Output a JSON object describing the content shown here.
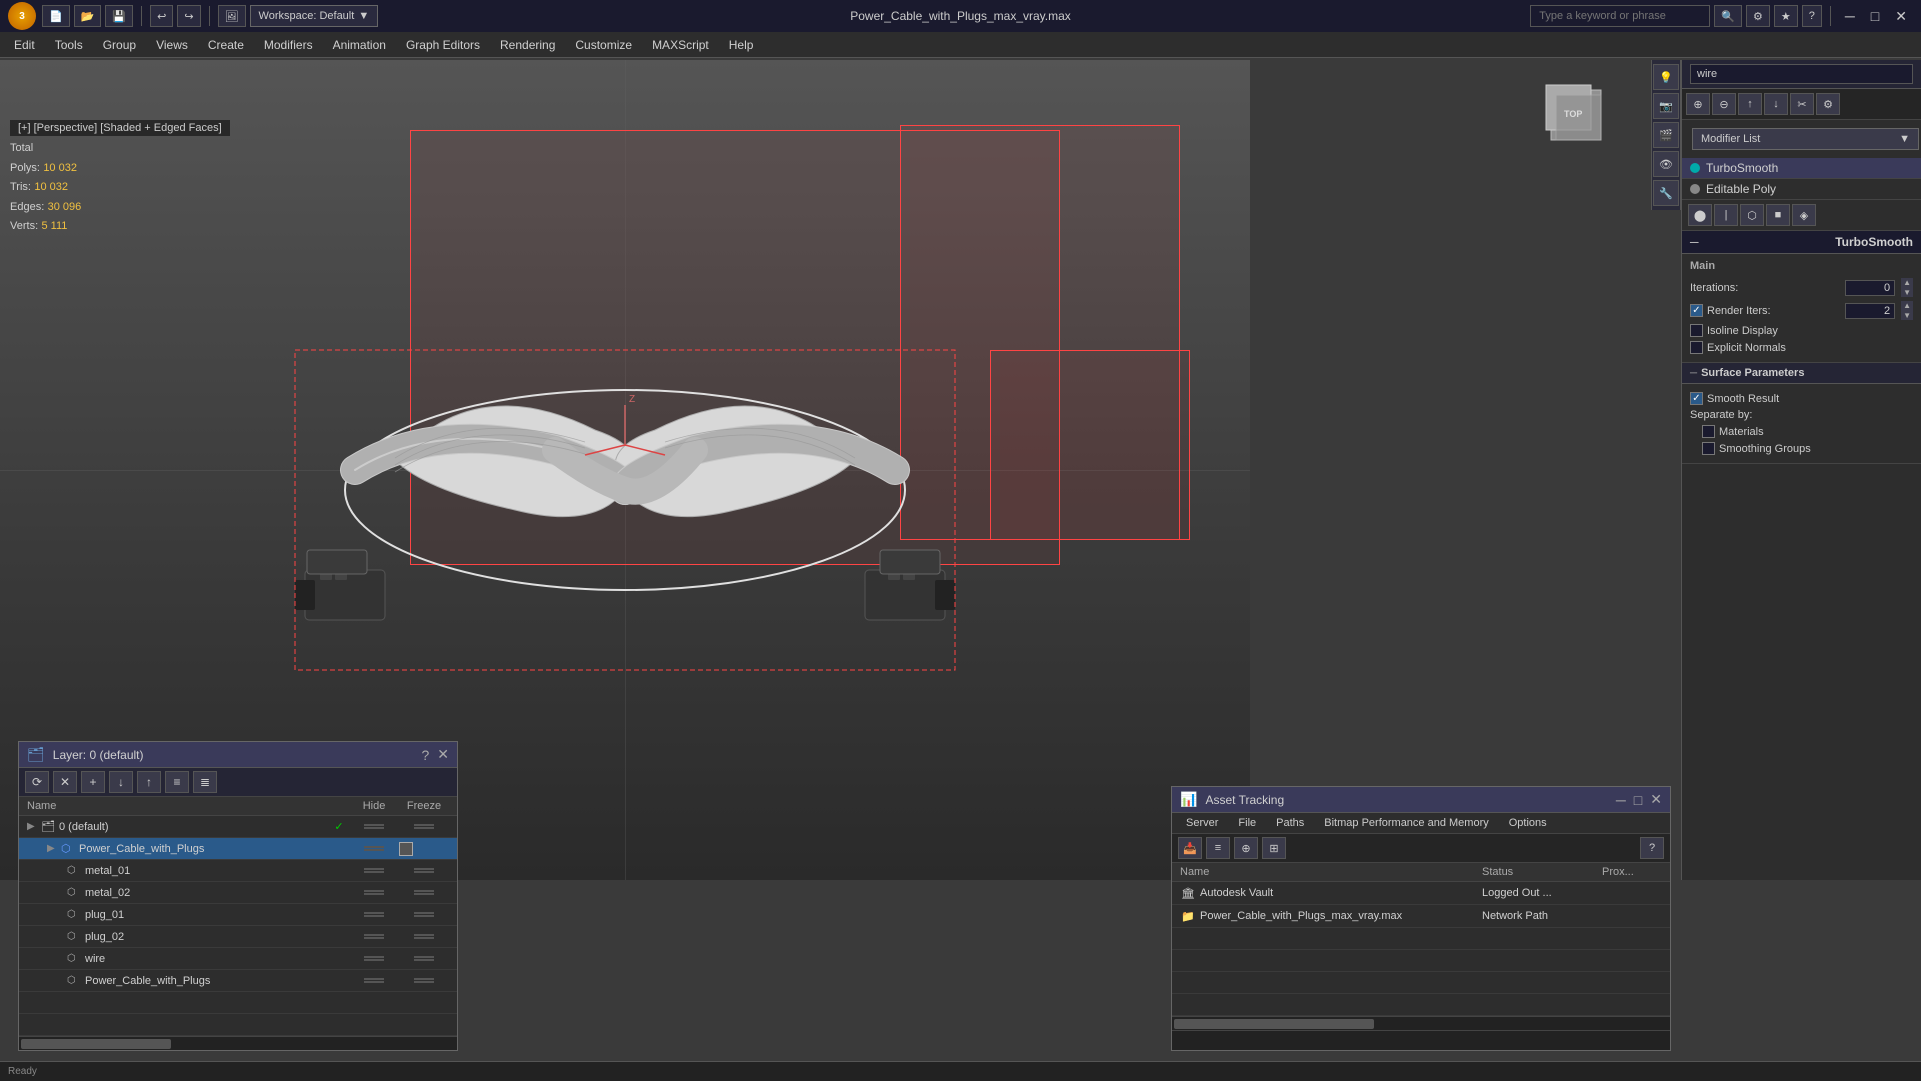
{
  "title_bar": {
    "app_name": "3ds Max",
    "file_title": "Power_Cable_with_Plugs_max_vray.max",
    "workspace_label": "Workspace: Default",
    "search_placeholder": "Type a keyword or phrase",
    "window_controls": [
      "minimize",
      "maximize",
      "close"
    ]
  },
  "menu_bar": {
    "items": [
      "Edit",
      "Tools",
      "Group",
      "Views",
      "Create",
      "Modifiers",
      "Animation",
      "Graph Editors",
      "Rendering",
      "Customize",
      "MAXScript",
      "Help"
    ]
  },
  "viewport": {
    "label": "[+] [Perspective] [Shaded + Edged Faces]",
    "stats": {
      "total_label": "Total",
      "polys_label": "Polys:",
      "polys_value": "10 032",
      "tris_label": "Tris:",
      "tris_value": "10 032",
      "edges_label": "Edges:",
      "edges_value": "30 096",
      "verts_label": "Verts:",
      "verts_value": "5 111"
    }
  },
  "right_panel": {
    "search_value": "wire",
    "modifier_list_label": "Modifier List",
    "modifiers": [
      {
        "name": "TurboSmooth",
        "active": true,
        "dot_color": "teal"
      },
      {
        "name": "Editable Poly",
        "active": false,
        "dot_color": "gray"
      }
    ],
    "turbosmooth": {
      "title": "TurboSmooth",
      "main_label": "Main",
      "iterations_label": "Iterations:",
      "iterations_value": "0",
      "render_iters_label": "Render Iters:",
      "render_iters_value": "2",
      "render_iters_checked": true,
      "isoline_display_label": "Isoline Display",
      "isoline_checked": false,
      "explicit_normals_label": "Explicit Normals",
      "explicit_normals_checked": false,
      "surface_params_title": "Surface Parameters",
      "smooth_result_label": "Smooth Result",
      "smooth_result_checked": true,
      "separate_by_label": "Separate by:",
      "materials_label": "Materials",
      "materials_checked": false,
      "smoothing_groups_label": "Smoothing Groups",
      "smoothing_groups_checked": false
    }
  },
  "layer_panel": {
    "title": "Layer: 0 (default)",
    "help_btn": "?",
    "toolbar_tools": [
      "⟳",
      "✕",
      "+",
      "↓↑",
      "⇅",
      "≡",
      "≣"
    ],
    "columns": {
      "name": "Name",
      "hide": "Hide",
      "freeze": "Freeze"
    },
    "layers": [
      {
        "indent": 0,
        "expand": "▶",
        "icon": "layer",
        "name": "0 (default)",
        "check": "✓",
        "has_box": false
      },
      {
        "indent": 1,
        "expand": "▶",
        "icon": "group",
        "name": "Power_Cable_with_Plugs",
        "check": "",
        "has_box": true,
        "selected": true
      },
      {
        "indent": 2,
        "expand": "",
        "icon": "obj",
        "name": "metal_01",
        "check": "",
        "has_box": false
      },
      {
        "indent": 2,
        "expand": "",
        "icon": "obj",
        "name": "metal_02",
        "check": "",
        "has_box": false
      },
      {
        "indent": 2,
        "expand": "",
        "icon": "obj",
        "name": "plug_01",
        "check": "",
        "has_box": false
      },
      {
        "indent": 2,
        "expand": "",
        "icon": "obj",
        "name": "plug_02",
        "check": "",
        "has_box": false
      },
      {
        "indent": 2,
        "expand": "",
        "icon": "obj",
        "name": "wire",
        "check": "",
        "has_box": false
      },
      {
        "indent": 2,
        "expand": "",
        "icon": "obj",
        "name": "Power_Cable_with_Plugs",
        "check": "",
        "has_box": false
      }
    ]
  },
  "asset_panel": {
    "title": "Asset Tracking",
    "menu_items": [
      "Server",
      "File",
      "Paths",
      "Bitmap Performance and Memory",
      "Options"
    ],
    "columns": {
      "name": "Name",
      "status": "Status",
      "proxy": "Prox..."
    },
    "rows": [
      {
        "icon": "vault",
        "name": "Autodesk Vault",
        "status": "Logged Out ...",
        "proxy": ""
      },
      {
        "icon": "max",
        "name": "Power_Cable_with_Plugs_max_vray.max",
        "status": "Network Path",
        "proxy": ""
      }
    ]
  },
  "icons": {
    "search": "🔍",
    "gear": "⚙",
    "star": "★",
    "help": "?",
    "close": "✕",
    "minimize": "─",
    "maximize": "□",
    "collapse": "─",
    "expand_arrow": "▶",
    "down_arrow": "▼"
  }
}
